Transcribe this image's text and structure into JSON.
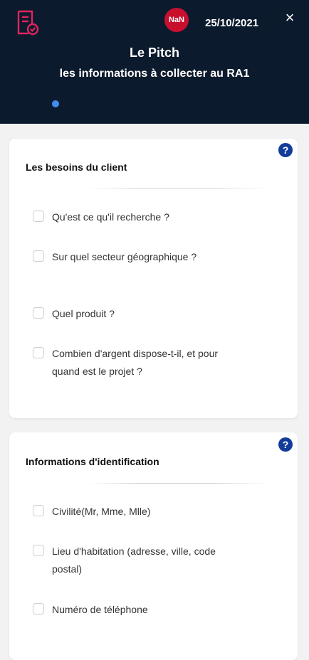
{
  "header": {
    "avatar_text": "NaN",
    "date": "25/10/2021",
    "close_symbol": "×",
    "title": "Le Pitch",
    "subtitle": "les informations à collecter au RA1"
  },
  "colors": {
    "header_bg": "#0c1a2d",
    "doc_icon": "#e0245e",
    "avatar_bg": "#c8102e",
    "dot": "#3f8ef0",
    "help_bg": "#123c9a"
  },
  "sections": [
    {
      "title": "Les besoins du client",
      "help_symbol": "?",
      "items": [
        {
          "label": "Qu'est ce qu'il recherche ?",
          "checked": false
        },
        {
          "label": "Sur quel secteur géographique ?",
          "checked": false
        },
        {
          "label": "Quel produit ?",
          "checked": false
        },
        {
          "label": "Combien d'argent dispose-t-il, et pour quand est le projet ?",
          "checked": false
        }
      ]
    },
    {
      "title": "Informations d'identification",
      "help_symbol": "?",
      "items": [
        {
          "label": "Civilité(Mr, Mme, Mlle)",
          "checked": false
        },
        {
          "label": "Lieu d'habitation (adresse, ville, code postal)",
          "checked": false
        },
        {
          "label": "Numéro de téléphone",
          "checked": false
        }
      ]
    }
  ]
}
